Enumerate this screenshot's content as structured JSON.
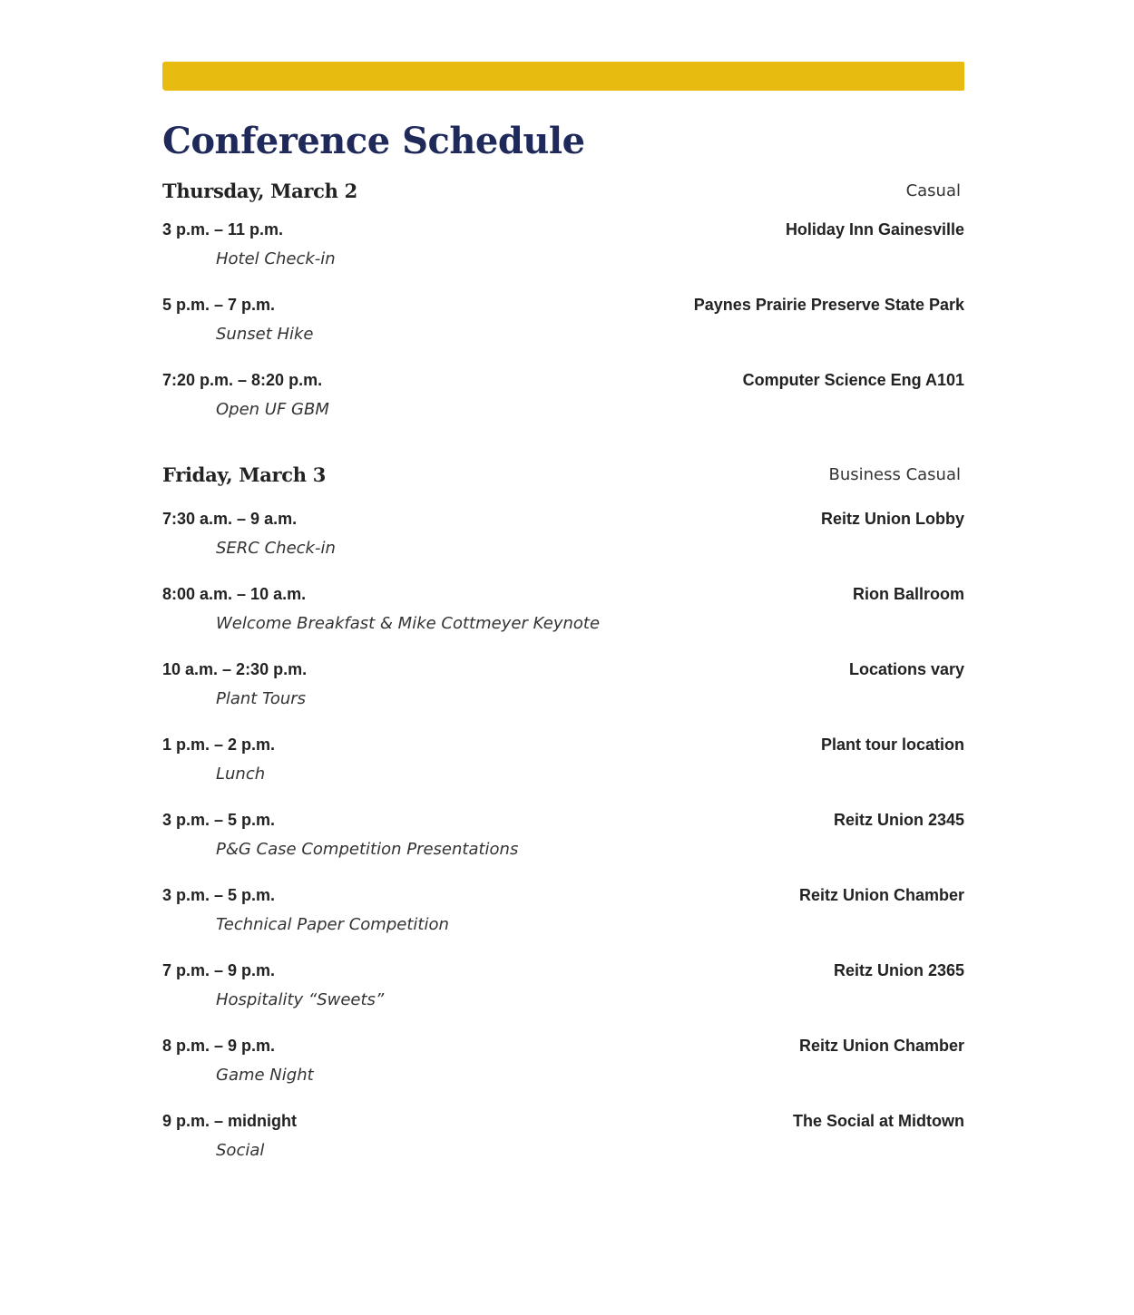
{
  "title": "Conference Schedule",
  "accent_color": "#e8bb10",
  "title_color": "#1f2a5a",
  "days": [
    {
      "label": "Thursday, March 2",
      "dress_code": "Casual",
      "events": [
        {
          "time": "3 p.m. – 11 p.m.",
          "location": "Holiday Inn Gainesville",
          "name": "Hotel Check-in"
        },
        {
          "time": "5 p.m. – 7 p.m.",
          "location": "Paynes Prairie Preserve State Park",
          "name": "Sunset Hike"
        },
        {
          "time": "7:20 p.m. – 8:20 p.m.",
          "location": "Computer Science Eng A101",
          "name": "Open UF GBM"
        }
      ]
    },
    {
      "label": "Friday, March 3",
      "dress_code": "Business Casual",
      "events": [
        {
          "time": "7:30 a.m. – 9 a.m.",
          "location": "Reitz Union Lobby",
          "name": "SERC Check-in"
        },
        {
          "time": "8:00 a.m. – 10 a.m.",
          "location": "Rion Ballroom",
          "name": "Welcome Breakfast & Mike Cottmeyer Keynote"
        },
        {
          "time": "10 a.m. – 2:30 p.m.",
          "location": "Locations vary",
          "name": "Plant Tours"
        },
        {
          "time": "1 p.m. – 2 p.m.",
          "location": "Plant tour location",
          "name": "Lunch"
        },
        {
          "time": "3 p.m. – 5 p.m.",
          "location": "Reitz Union 2345",
          "name": "P&G Case Competition Presentations"
        },
        {
          "time": "3 p.m. – 5 p.m.",
          "location": "Reitz Union Chamber",
          "name": "Technical Paper Competition"
        },
        {
          "time": "7 p.m. – 9 p.m.",
          "location": "Reitz Union 2365",
          "name": "Hospitality “Sweets”"
        },
        {
          "time": "8 p.m. – 9 p.m.",
          "location": "Reitz Union Chamber",
          "name": "Game Night"
        },
        {
          "time": "9 p.m. – midnight",
          "location": "The Social at Midtown",
          "name": "Social"
        }
      ]
    }
  ]
}
